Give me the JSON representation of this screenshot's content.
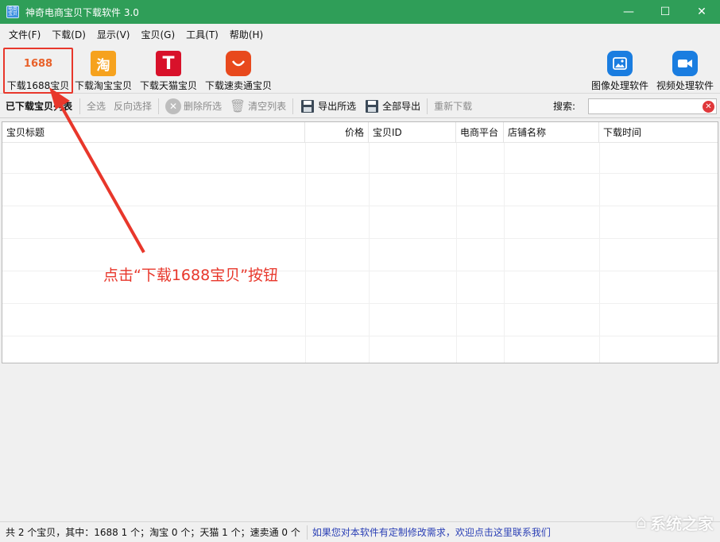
{
  "window": {
    "title": "神奇电商宝贝下载软件 3.0",
    "icon_text": "电商\n宝贝",
    "controls": [
      "minimize-icon",
      "maximize-icon",
      "close-icon"
    ]
  },
  "menu": [
    {
      "label": "文件(F)"
    },
    {
      "label": "下载(D)"
    },
    {
      "label": "显示(V)"
    },
    {
      "label": "宝贝(G)"
    },
    {
      "label": "工具(T)"
    },
    {
      "label": "帮助(H)"
    }
  ],
  "big_toolbar": {
    "download_1688": {
      "icon_text": "1688",
      "label": "下载1688宝贝"
    },
    "download_taobao": {
      "icon_text": "淘",
      "label": "下载淘宝宝贝"
    },
    "download_tmall": {
      "icon_text": "T",
      "label": "下载天猫宝贝"
    },
    "download_aliexpress": {
      "label": "下载速卖通宝贝"
    },
    "image_tool": {
      "label": "图像处理软件"
    },
    "video_tool": {
      "label": "视频处理软件"
    }
  },
  "small_toolbar": {
    "title": "已下载宝贝列表",
    "select_all": "全选",
    "invert_select": "反向选择",
    "delete_selected": "删除所选",
    "clear_list": "清空列表",
    "export_selected": "导出所选",
    "export_all": "全部导出",
    "redownload": "重新下载",
    "search_label": "搜索:",
    "search_value": ""
  },
  "table": {
    "columns": [
      "宝贝标题",
      "价格",
      "宝贝ID",
      "电商平台",
      "店铺名称",
      "下载时间"
    ],
    "rows": []
  },
  "annotation": {
    "text": "点击“下载1688宝贝”按钮",
    "color": "#e8372b"
  },
  "status": {
    "summary": "共 2 个宝贝，其中：1688 1 个；淘宝 0 个；天猫 1 个；速卖通 0 个",
    "link": "如果您对本软件有定制修改需求，欢迎点击这里联系我们"
  },
  "watermark": {
    "text": "系统之家"
  },
  "colors": {
    "titlebar": "#2f9e58",
    "accent_red": "#e8372b",
    "link": "#2a3fb5"
  }
}
